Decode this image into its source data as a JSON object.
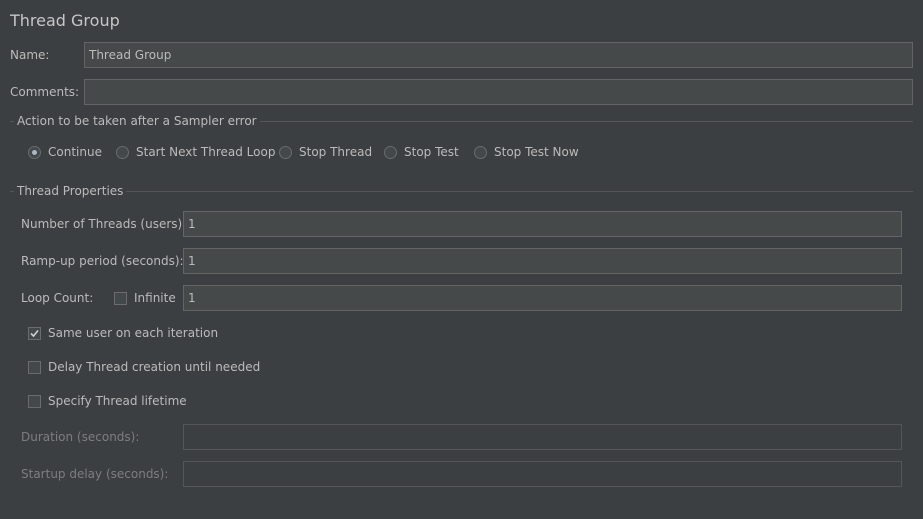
{
  "panel": {
    "title": "Thread Group"
  },
  "name": {
    "label": "Name:",
    "value": "Thread Group"
  },
  "comments": {
    "label": "Comments:",
    "value": ""
  },
  "sampler_error": {
    "title": "Action to be taken after a Sampler error",
    "options": [
      {
        "label": "Continue",
        "selected": true
      },
      {
        "label": "Start Next Thread Loop",
        "selected": false
      },
      {
        "label": "Stop Thread",
        "selected": false
      },
      {
        "label": "Stop Test",
        "selected": false
      },
      {
        "label": "Stop Test Now",
        "selected": false
      }
    ]
  },
  "thread_props": {
    "title": "Thread Properties",
    "num_threads": {
      "label": "Number of Threads (users):",
      "value": "1"
    },
    "ramp_up": {
      "label": "Ramp-up period (seconds):",
      "value": "1"
    },
    "loop_count": {
      "label": "Loop Count:",
      "infinite_label": "Infinite",
      "infinite_checked": false,
      "value": "1"
    },
    "same_user": {
      "label": "Same user on each iteration",
      "checked": true
    },
    "delay_creation": {
      "label": "Delay Thread creation until needed",
      "checked": false
    },
    "specify_lifetime": {
      "label": "Specify Thread lifetime",
      "checked": false
    },
    "duration": {
      "label": "Duration (seconds):",
      "value": ""
    },
    "startup_delay": {
      "label": "Startup delay (seconds):",
      "value": ""
    }
  },
  "icons": {
    "check": "checkmark-icon"
  },
  "colors": {
    "background": "#3c3f41",
    "field": "#45494a",
    "border": "#646464",
    "text": "#bbbbbb"
  }
}
